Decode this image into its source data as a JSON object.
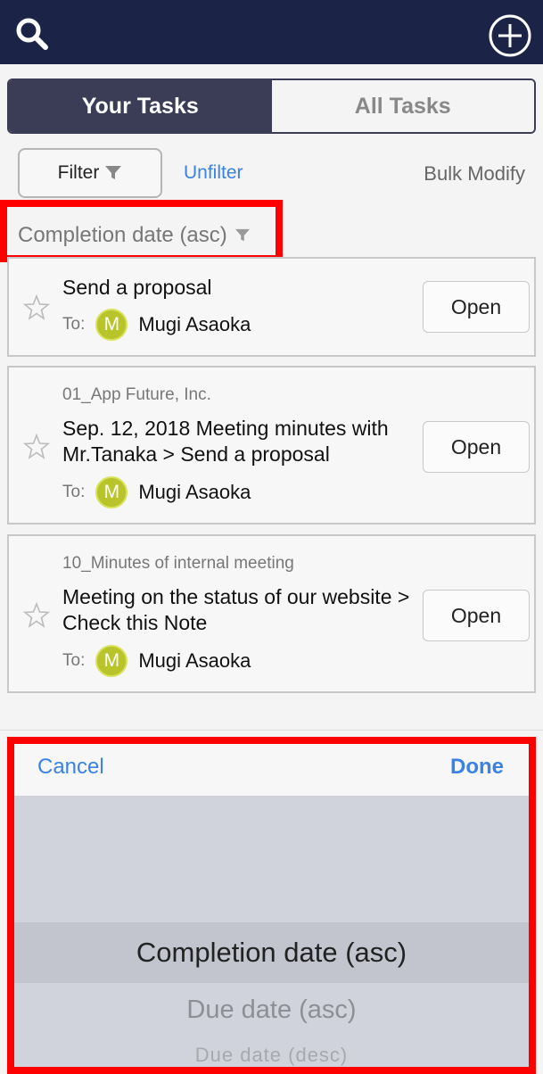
{
  "header": {
    "search_icon": "search-icon",
    "add_icon": "plus-circle-icon",
    "background": "#1b2447"
  },
  "tabs": {
    "your_tasks": "Your Tasks",
    "all_tasks": "All Tasks"
  },
  "toolbar": {
    "filter_label": "Filter",
    "unfilter_label": "Unfilter",
    "bulk_modify_label": "Bulk Modify"
  },
  "sort": {
    "label": "Completion date (asc)"
  },
  "tasks": [
    {
      "group": "",
      "title": "Send a proposal",
      "to_label": "To:",
      "avatar_initial": "M",
      "assignee": "Mugi Asaoka",
      "open_label": "Open"
    },
    {
      "group": "01_App Future, Inc.",
      "title": "Sep. 12, 2018 Meeting minutes with Mr.Tanaka  > Send a proposal",
      "to_label": "To:",
      "avatar_initial": "M",
      "assignee": "Mugi Asaoka",
      "open_label": "Open"
    },
    {
      "group": "10_Minutes of internal meeting",
      "title": "Meeting on the status of our website > Check this Note",
      "to_label": "To:",
      "avatar_initial": "M",
      "assignee": "Mugi Asaoka",
      "open_label": "Open"
    }
  ],
  "picker": {
    "cancel_label": "Cancel",
    "done_label": "Done",
    "options": [
      "Completion date (asc)",
      "Due date (asc)",
      "Due date (desc)"
    ],
    "selected": "Completion date (asc)"
  },
  "colors": {
    "accent": "#3a82e4",
    "highlight": "#ff0000",
    "avatar": "#b8c42a"
  }
}
